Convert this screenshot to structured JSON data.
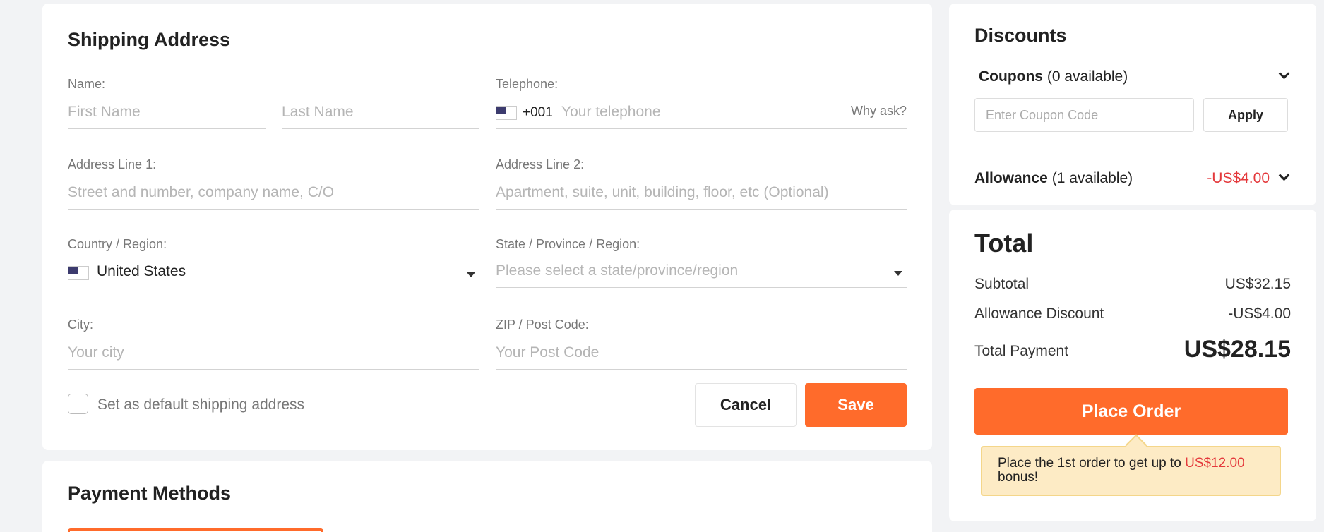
{
  "shipping": {
    "title": "Shipping Address",
    "name_label": "Name:",
    "first_name_placeholder": "First Name",
    "last_name_placeholder": "Last Name",
    "telephone_label": "Telephone:",
    "phone_code": "+001",
    "telephone_placeholder": "Your telephone",
    "why_ask": "Why ask?",
    "address1_label": "Address Line 1:",
    "address1_placeholder": "Street and number, company name, C/O",
    "address2_label": "Address Line 2:",
    "address2_placeholder": "Apartment, suite, unit, building, floor, etc (Optional)",
    "country_label": "Country / Region:",
    "country_value": "United States",
    "state_label": "State / Province / Region:",
    "state_placeholder": "Please select a state/province/region",
    "city_label": "City:",
    "city_placeholder": "Your city",
    "zip_label": "ZIP / Post Code:",
    "zip_placeholder": "Your Post Code",
    "default_checkbox_label": "Set as default shipping address",
    "cancel_label": "Cancel",
    "save_label": "Save"
  },
  "payment": {
    "title": "Payment Methods"
  },
  "discounts": {
    "title": "Discounts",
    "coupons_label": "Coupons",
    "coupons_available": "(0 available)",
    "coupon_placeholder": "Enter Coupon Code",
    "apply_label": "Apply",
    "allowance_label": "Allowance",
    "allowance_available": "(1 available)",
    "allowance_amount": "-US$4.00"
  },
  "total": {
    "title": "Total",
    "subtotal_label": "Subtotal",
    "subtotal_value": "US$32.15",
    "allowance_discount_label": "Allowance Discount",
    "allowance_discount_value": "-US$4.00",
    "total_payment_label": "Total Payment",
    "total_payment_value": "US$28.15",
    "place_order_label": "Place Order",
    "tip_prefix": "Place the 1st order to get up to",
    "tip_amount": "US$12.00",
    "tip_suffix": "bonus!"
  },
  "colors": {
    "accent": "#ff6b2b",
    "discount_red": "#e4393c",
    "tip_bg": "#fdebc5"
  }
}
